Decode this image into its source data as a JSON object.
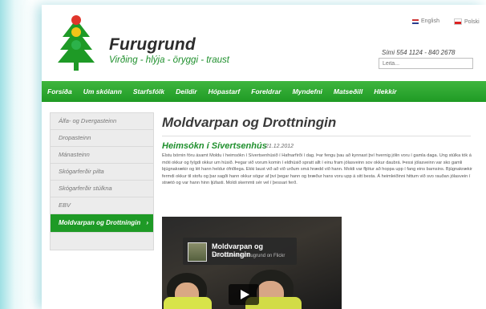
{
  "header": {
    "brand_name": "Furugrund",
    "tagline": "Virðing - hlýja - öryggi - traust",
    "lang_en": "English",
    "lang_pl": "Polski",
    "phone": "Sími 554 1124 - 840 2678",
    "search_placeholder": "Leita..."
  },
  "nav": [
    "Forsíða",
    "Um skólann",
    "Starfsfólk",
    "Deildir",
    "Hópastarf",
    "Foreldrar",
    "Myndefni",
    "Matseðill",
    "Hlekkir"
  ],
  "sidebar": [
    "Álfa- og Dvergasteinn",
    "Dropasteinn",
    "Mánasteinn",
    "Skógarferðir pilta",
    "Skógarferðir stúlkna",
    "EBV",
    "Moldvarpan og Drottningin"
  ],
  "main": {
    "title": "Moldvarpan og Drottningin",
    "subtitle": "Heimsókn í Sívertsenhús",
    "date": "21.12.2012",
    "body": "Elstu börnin fóru ásamt Moldu í heimsókn í Sívertsenhúsið í Hafnarfirði í dag. Þar fengu þau að kynnast því hvernig jólin voru í gamla daga. Ung stúlka tók á móti okkur og fylgdi okkur um húsið. Þegar við vorum komin í eldhúsið spratt allt í einu fram jólasveinn sov okkur daubrá. Þessi jólasveinn var sko gamli bjúgnakrækir og lét hann heldur ófriðlega. Ekki laust við að við urðum smá hrædd við hann. Moldi var fljótur að hoppa upp í fang eins barnsins. Bjúgnakrækir fermdi okkur til stofu og þar sagði hann okkur sögur af því þegar hann og bræður hans voru upp á sitt besta. Á heimleiðinni hittum við svo rauðan jólasvein í strætó og var hann hinn ljúfasti. Moldi skemmti sér vel í þessari ferð."
  },
  "video": {
    "title": "Moldvarpan og Drottningin",
    "source": "from leikskolinnfurugrund on Flickr"
  },
  "colors": {
    "brand_green": "#1e9a26",
    "heading_text": "#3a3a3a"
  }
}
